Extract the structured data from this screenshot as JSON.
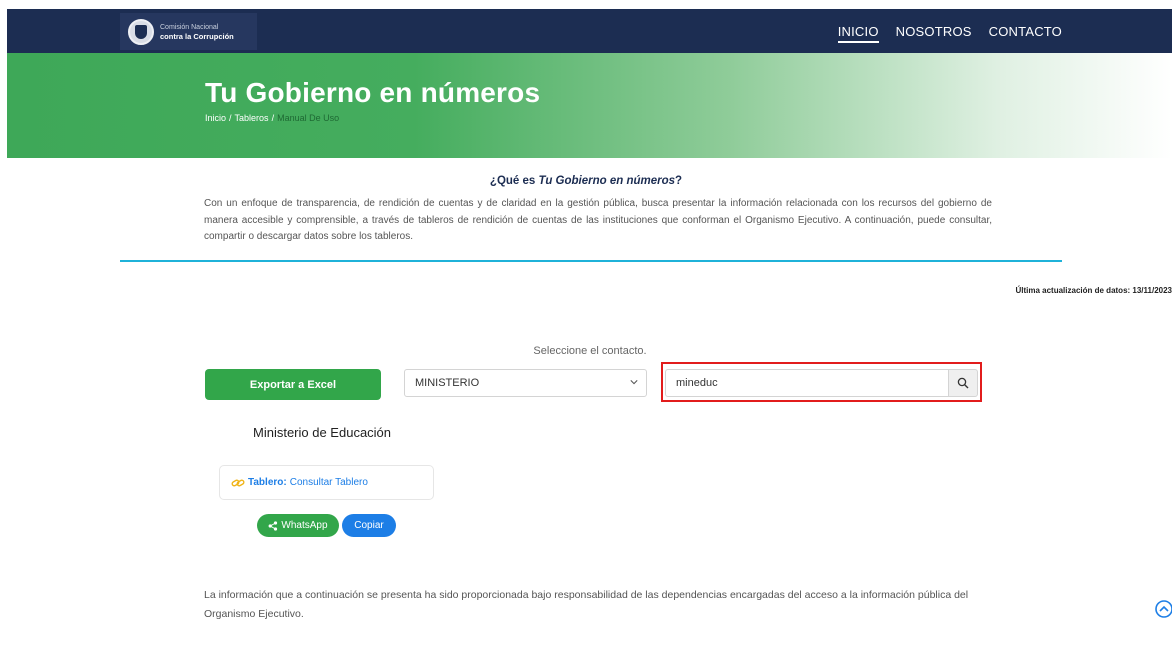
{
  "header": {
    "logo": {
      "line1": "Comisión Nacional",
      "line2": "contra la Corrupción"
    },
    "nav": [
      {
        "label": "INICIO",
        "active": true
      },
      {
        "label": "NOSOTROS",
        "active": false
      },
      {
        "label": "CONTACTO",
        "active": false
      }
    ]
  },
  "hero": {
    "title": "Tu Gobierno en números",
    "breadcrumb": {
      "home": "Inicio",
      "sep1": "/",
      "section": "Tableros",
      "sep2": "/",
      "current": "Manual De Uso"
    }
  },
  "about": {
    "heading_prefix": "¿Qué es ",
    "heading_emphasis": "Tu Gobierno en números",
    "heading_suffix": "?",
    "text": "Con un enfoque de transparencia, de rendición de cuentas y de claridad en la gestión pública, busca presentar la información relacionada con los recursos del gobierno de manera accesible y comprensible, a través de tableros de rendición de cuentas de las instituciones que conforman el Organismo Ejecutivo. A continuación, puede consultar, compartir o descargar datos sobre los tableros."
  },
  "last_update": "Última actualización de datos: 13/11/2023",
  "filters": {
    "label": "Seleccione el contacto.",
    "export_label": "Exportar a Excel",
    "select_value": "MINISTERIO",
    "search_value": "mineduc"
  },
  "result": {
    "name": "Ministerio de Educación",
    "card_label": "Tablero:",
    "card_link": "Consultar Tablero",
    "whatsapp_label": "WhatsApp",
    "copy_label": "Copiar"
  },
  "footer_note": "La información que a continuación se presenta ha sido proporcionada bajo responsabilidad de las dependencias encargadas del acceso a la información pública del Organismo Ejecutivo.",
  "colors": {
    "navbar": "#1c2d52",
    "accent_green": "#32a64a",
    "accent_blue": "#1d7ee6",
    "divider": "#1fb2d9",
    "highlight": "#e21c1c"
  },
  "icons": [
    "seal-icon",
    "chevron-down-icon",
    "search-icon",
    "link-icon",
    "share-icon",
    "scroll-top-icon"
  ]
}
